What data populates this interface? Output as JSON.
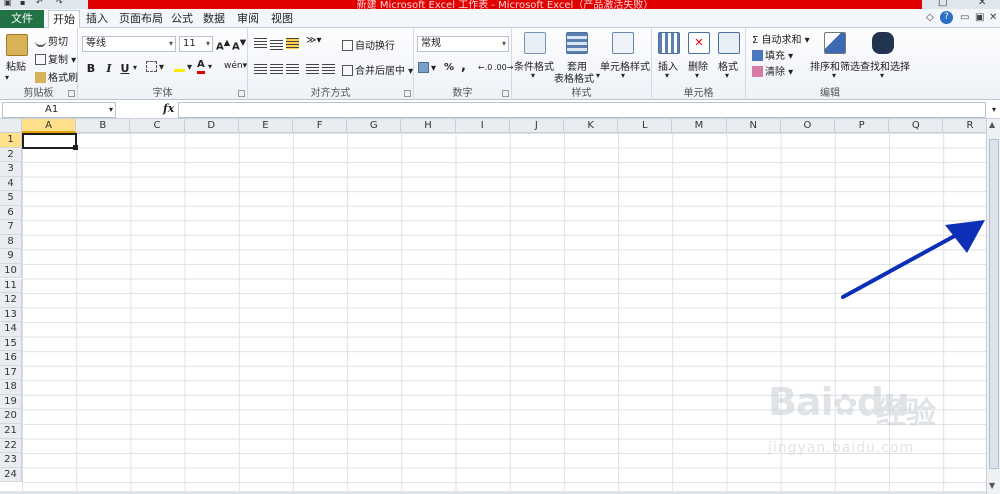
{
  "window": {
    "title": "新建 Microsoft Excel 工作表 - Microsoft Excel（产品激活失败）"
  },
  "tabs": [
    "文件",
    "开始",
    "插入",
    "页面布局",
    "公式",
    "数据",
    "审阅",
    "视图"
  ],
  "active_tab": "开始",
  "ribbon": {
    "clipboard": {
      "label": "剪贴板",
      "paste": "粘贴",
      "cut": "剪切",
      "copy": "复制",
      "format_painter": "格式刷"
    },
    "font": {
      "label": "字体",
      "font_name": "等线",
      "font_size": "11",
      "bold": "B",
      "italic": "I",
      "underline": "U"
    },
    "alignment": {
      "label": "对齐方式",
      "wrap": "自动换行",
      "merge": "合并后居中"
    },
    "number": {
      "label": "数字",
      "format": "常规",
      "percent": "%",
      "comma": ","
    },
    "styles": {
      "label": "样式",
      "conditional": "条件格式",
      "table_top": "套用",
      "table_bottom": "表格格式",
      "cell_styles": "单元格样式"
    },
    "cells": {
      "label": "单元格",
      "insert": "插入",
      "delete": "删除",
      "format": "格式"
    },
    "editing": {
      "label": "编辑",
      "autosum": "自动求和",
      "fill": "填充",
      "clear": "清除",
      "sort": "排序和筛选",
      "find": "查找和选择"
    }
  },
  "formula_bar": {
    "name_box": "A1",
    "fx": "fx",
    "value": ""
  },
  "grid": {
    "columns": [
      "A",
      "B",
      "C",
      "D",
      "E",
      "F",
      "G",
      "H",
      "I",
      "J",
      "K",
      "L",
      "M",
      "N",
      "O",
      "P",
      "Q",
      "R"
    ],
    "rows": [
      "1",
      "2",
      "3",
      "4",
      "5",
      "6",
      "7",
      "8",
      "9",
      "10",
      "11",
      "12",
      "13",
      "14",
      "15",
      "16",
      "17",
      "18",
      "19",
      "20",
      "21",
      "22",
      "23",
      "24"
    ],
    "active_cell": "A1"
  },
  "annotation": {
    "color": "#0d2fb8"
  },
  "watermark": {
    "brand": "Bai",
    "brand_tail": "du",
    "cn": "经验",
    "url": "jingyan.baidu.com"
  },
  "colors": {
    "file_tab": "#217346",
    "title_bar": "#e00000",
    "selected_header": "#ffe08a"
  }
}
